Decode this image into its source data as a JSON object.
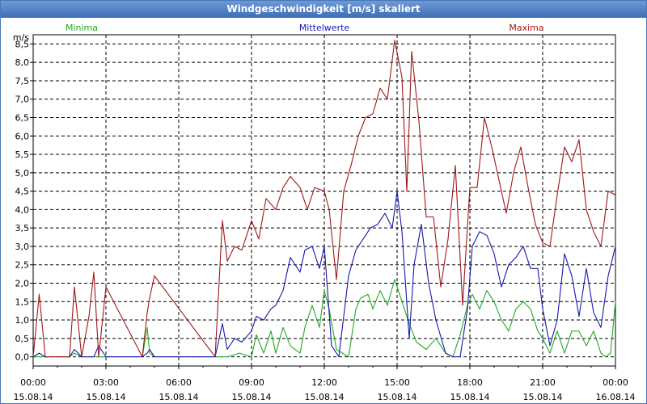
{
  "window": {
    "title": "Windgeschwindigkeit [m/s] skaliert"
  },
  "chart_data": {
    "type": "line",
    "title": "Windgeschwindigkeit [m/s] skaliert",
    "ylabel": "m/s",
    "xlabel": "",
    "ylim": [
      -0.25,
      8.75
    ],
    "y_ticks": [
      "0,0",
      "0,5",
      "1,0",
      "1,5",
      "2,0",
      "2,5",
      "3,0",
      "3,5",
      "4,0",
      "4,5",
      "5,0",
      "5,5",
      "6,0",
      "6,5",
      "7,0",
      "7,5",
      "8,0",
      "8,5"
    ],
    "x_ticks": [
      {
        "time": "00:00",
        "date": "15.08.14"
      },
      {
        "time": "03:00",
        "date": "15.08.14"
      },
      {
        "time": "06:00",
        "date": "15.08.14"
      },
      {
        "time": "09:00",
        "date": "15.08.14"
      },
      {
        "time": "12:00",
        "date": "15.08.14"
      },
      {
        "time": "15:00",
        "date": "15.08.14"
      },
      {
        "time": "18:00",
        "date": "15.08.14"
      },
      {
        "time": "21:00",
        "date": "15.08.14"
      },
      {
        "time": "00:00",
        "date": "16.08.14"
      }
    ],
    "xlim_hours": [
      0,
      24
    ],
    "grid": true,
    "legend_placement": "top",
    "series": [
      {
        "name": "Minima",
        "color": "#22aa22",
        "x": [
          0,
          0.25,
          0.5,
          1.5,
          1.7,
          2.0,
          2.3,
          2.5,
          2.7,
          3.0,
          4.5,
          4.7,
          4.8,
          5.0,
          7.5,
          7.8,
          8.0,
          8.5,
          9.0,
          9.2,
          9.5,
          9.8,
          10.0,
          10.3,
          10.6,
          11.0,
          11.2,
          11.5,
          11.8,
          12.0,
          12.2,
          12.5,
          13.0,
          13.3,
          13.5,
          13.8,
          14.0,
          14.3,
          14.6,
          14.9,
          15.2,
          15.5,
          15.8,
          16.2,
          16.6,
          17.0,
          17.3,
          17.6,
          17.9,
          18.1,
          18.4,
          18.7,
          19.0,
          19.3,
          19.6,
          19.9,
          20.2,
          20.5,
          20.8,
          21.0,
          21.3,
          21.6,
          21.9,
          22.2,
          22.5,
          22.8,
          23.1,
          23.4,
          23.6,
          23.8,
          24.0
        ],
        "y": [
          0,
          0,
          0,
          0,
          0.1,
          0,
          0,
          0,
          0,
          0,
          0,
          0.8,
          0.1,
          0,
          0,
          0,
          0,
          0.1,
          0,
          0.6,
          0.1,
          0.7,
          0.1,
          0.8,
          0.3,
          0.1,
          0.8,
          1.4,
          0.8,
          1.8,
          1.3,
          0.2,
          0,
          1.3,
          1.6,
          1.7,
          1.3,
          1.8,
          1.4,
          2.1,
          1.5,
          0.9,
          0.4,
          0.2,
          0.5,
          0.1,
          0,
          0.6,
          1.4,
          1.7,
          1.3,
          1.8,
          1.5,
          1.0,
          0.7,
          1.3,
          1.5,
          1.3,
          0.7,
          0.5,
          0.1,
          0.7,
          0.1,
          0.7,
          0.7,
          0.3,
          0.7,
          0.1,
          0,
          0.1,
          1.5
        ]
      },
      {
        "name": "Mittelwerte",
        "color": "#1818b0",
        "x": [
          0,
          0.25,
          0.5,
          1.5,
          1.7,
          2.0,
          2.5,
          2.7,
          3.0,
          4.5,
          4.7,
          4.8,
          5.0,
          7.5,
          7.8,
          8.0,
          8.3,
          8.6,
          9.0,
          9.2,
          9.5,
          9.8,
          10.0,
          10.3,
          10.6,
          11.0,
          11.2,
          11.5,
          11.8,
          12.0,
          12.3,
          12.6,
          13.0,
          13.3,
          13.6,
          13.9,
          14.2,
          14.5,
          14.8,
          15.0,
          15.2,
          15.5,
          15.7,
          16.0,
          16.3,
          16.6,
          17.0,
          17.3,
          17.6,
          17.9,
          18.1,
          18.4,
          18.7,
          19.0,
          19.3,
          19.6,
          19.9,
          20.2,
          20.5,
          20.8,
          21.0,
          21.3,
          21.6,
          21.9,
          22.2,
          22.5,
          22.8,
          23.1,
          23.4,
          23.7,
          24.0
        ],
        "y": [
          0,
          0.1,
          0,
          0,
          0.2,
          0,
          0,
          0.3,
          0,
          0,
          0.1,
          0.2,
          0,
          0,
          0.9,
          0.2,
          0.5,
          0.4,
          0.7,
          1.1,
          1.0,
          1.3,
          1.4,
          1.8,
          2.7,
          2.3,
          2.9,
          3.0,
          2.4,
          3.0,
          0.3,
          0,
          2.2,
          2.9,
          3.2,
          3.5,
          3.6,
          3.9,
          3.5,
          4.5,
          3.4,
          0.5,
          2.5,
          3.6,
          2.0,
          1.0,
          0.1,
          0,
          0,
          1.3,
          3.0,
          3.4,
          3.3,
          2.8,
          1.9,
          2.5,
          2.7,
          3.0,
          2.4,
          2.4,
          1.3,
          0.3,
          1.0,
          2.8,
          2.2,
          1.1,
          2.4,
          1.2,
          0.8,
          2.2,
          3.0
        ]
      },
      {
        "name": "Maxima",
        "color": "#a01818",
        "x": [
          0,
          0.25,
          0.5,
          1.5,
          1.7,
          2.0,
          2.3,
          2.5,
          2.7,
          3.0,
          4.5,
          4.7,
          4.8,
          5.0,
          7.5,
          7.8,
          8.0,
          8.3,
          8.6,
          9.0,
          9.3,
          9.6,
          10.0,
          10.3,
          10.6,
          11.0,
          11.3,
          11.6,
          12.0,
          12.2,
          12.5,
          12.8,
          13.1,
          13.4,
          13.7,
          14.0,
          14.3,
          14.6,
          14.9,
          15.2,
          15.4,
          15.6,
          15.9,
          16.2,
          16.5,
          16.8,
          17.1,
          17.4,
          17.7,
          18.0,
          18.3,
          18.6,
          18.9,
          19.2,
          19.5,
          19.8,
          20.1,
          20.4,
          20.7,
          21.0,
          21.3,
          21.6,
          21.9,
          22.2,
          22.5,
          22.8,
          23.1,
          23.4,
          23.7,
          24.0
        ],
        "y": [
          0,
          1.7,
          0,
          0,
          1.9,
          0,
          1.1,
          2.3,
          0,
          1.9,
          0,
          1.2,
          1.6,
          2.2,
          0,
          3.7,
          2.6,
          3.0,
          2.9,
          3.7,
          3.2,
          4.3,
          4.0,
          4.6,
          4.9,
          4.6,
          4.0,
          4.6,
          4.5,
          4.0,
          2.1,
          4.5,
          5.2,
          6.0,
          6.5,
          6.6,
          7.3,
          7.0,
          8.6,
          7.6,
          4.5,
          8.3,
          6.4,
          3.8,
          3.8,
          1.9,
          3.2,
          5.2,
          1.4,
          4.6,
          4.6,
          6.5,
          5.7,
          4.8,
          3.9,
          5.0,
          5.7,
          4.6,
          3.6,
          3.1,
          3.0,
          4.4,
          5.7,
          5.3,
          5.9,
          4.0,
          3.4,
          3.0,
          4.5,
          4.4
        ]
      }
    ]
  }
}
